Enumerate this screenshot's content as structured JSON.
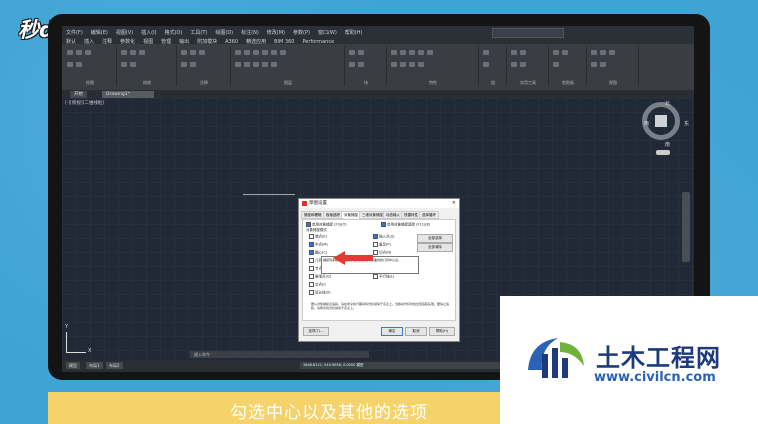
{
  "branding": {
    "left_logo": "秒dong视频",
    "watermark_title": "土木工程网",
    "watermark_url": "www.civilcn.com"
  },
  "subtitle": "勾选中心以及其他的选项",
  "menubar": {
    "items": [
      "文件(F)",
      "编辑(E)",
      "视图(V)",
      "插入(I)",
      "格式(O)",
      "工具(T)",
      "绘图(D)",
      "标注(N)",
      "修改(M)",
      "参数(P)",
      "窗口(W)",
      "帮助(H)"
    ],
    "ribbon_tabs": [
      "默认",
      "插入",
      "注释",
      "参数化",
      "视图",
      "管理",
      "输出",
      "附加模块",
      "A360",
      "精选应用",
      "BIM 360",
      "Performance"
    ]
  },
  "ribbon": {
    "groups": [
      "绘图",
      "修改",
      "注释",
      "图层",
      "块",
      "特性",
      "组",
      "实用工具",
      "剪贴板",
      "视图"
    ]
  },
  "doc_tabs": {
    "start": "开始",
    "drawing": "Drawing1*"
  },
  "canvas": {
    "view_label": "[-][俯视][二维线框]",
    "compass": {
      "n": "北",
      "s": "南",
      "w": "西",
      "e": "东",
      "top": "上",
      "wcs": "WCS"
    },
    "ucs_x": "X",
    "ucs_y": "Y",
    "command_placeholder": "键入命令"
  },
  "layout_tabs": [
    "模型",
    "布局1",
    "布局2"
  ],
  "statusbar": {
    "coords": "3846.8121, 544.9058, 0.0000",
    "mode": "模型"
  },
  "dialog": {
    "title": "草图设置",
    "close": "×",
    "tabs": [
      "捕捉和栅格",
      "极轴追踪",
      "对象捕捉",
      "三维对象捕捉",
      "动态输入",
      "快捷特性",
      "选择循环"
    ],
    "active_tab": "对象捕捉",
    "enable_snap": "启用对象捕捉 (F3)(O)",
    "enable_tracking": "启用对象捕捉追踪 (F11)(K)",
    "modes_label": "对象捕捉模式",
    "left_options": [
      "端点(E)",
      "中点(M)",
      "圆心(C)",
      "几何中心(G)",
      "节点(D)",
      "象限点(Q)",
      "交点(I)",
      "延长线(X)"
    ],
    "right_options": [
      "插入点(S)",
      "垂足(P)",
      "切点(N)",
      "最近点(R)",
      "外观交点(A)",
      "平行线(L)"
    ],
    "select_all": "全部选择",
    "clear_all": "全部清除",
    "tooltip": "捕捉到多段线、二维多段线和二维样条曲线的几何中心点。",
    "note": "要从对象捕捉点追踪，请在命令执行期间将光标悬停于该点上。当移动光标时会出现追踪矢量。要停止追踪，请再次将光标悬停于该点上。",
    "buttons": {
      "options": "选项(T)...",
      "ok": "确定",
      "cancel": "取消",
      "help": "帮助(H)"
    }
  },
  "colors": {
    "bg": "#3fa3d4",
    "canvas": "#212836",
    "arrow": "#e53935",
    "subtitle_bar": "#f6d36a"
  }
}
